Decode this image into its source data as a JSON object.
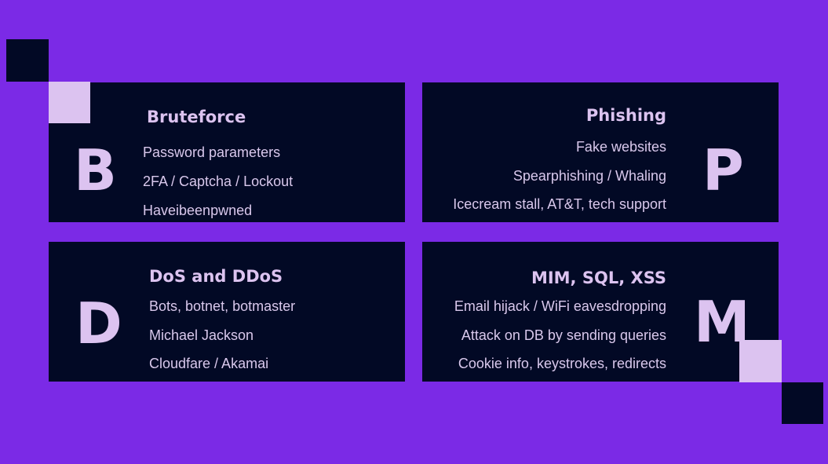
{
  "colors": {
    "background": "#7b2ae6",
    "card": "#020925",
    "accent": "#dcc3f0"
  },
  "cards": [
    {
      "letter": "B",
      "title": "Bruteforce",
      "lines": [
        "Password parameters",
        "2FA / Captcha / Lockout",
        "Haveibeenpwned"
      ]
    },
    {
      "letter": "P",
      "title": "Phishing",
      "lines": [
        "Fake websites",
        "Spearphishing / Whaling",
        "Icecream stall, AT&T,  tech support"
      ]
    },
    {
      "letter": "D",
      "title": "DoS and DDoS",
      "lines": [
        "Bots, botnet, botmaster",
        "Michael Jackson",
        "Cloudfare / Akamai"
      ]
    },
    {
      "letter": "M",
      "title": "MIM, SQL, XSS",
      "lines": [
        "Email hijack / WiFi eavesdropping",
        "Attack on DB by sending queries",
        "Cookie info, keystrokes, redirects"
      ]
    }
  ]
}
